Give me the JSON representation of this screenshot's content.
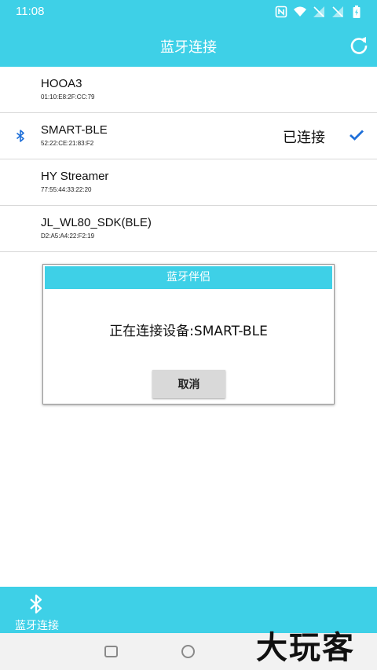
{
  "status_bar": {
    "time": "11:08"
  },
  "app_bar": {
    "title": "蓝牙连接"
  },
  "devices": [
    {
      "name": "HOOA3",
      "mac": "01:10:E8:2F:CC:79"
    },
    {
      "name": "SMART-BLE",
      "mac": "52:22:CE:21:83:F2",
      "status": "已连接"
    },
    {
      "name": "HY Streamer",
      "mac": "77:55:44:33:22:20"
    },
    {
      "name": "JL_WL80_SDK(BLE)",
      "mac": "D2:A5:A4:22:F2:19"
    }
  ],
  "dialog": {
    "title": "蓝牙伴侣",
    "message": "正在连接设备:SMART-BLE",
    "cancel_label": "取消"
  },
  "bottom_bar": {
    "tab_label": "蓝牙连接"
  },
  "watermark": "大玩客",
  "colors": {
    "accent": "#3ed0e7",
    "check": "#1e6fd9"
  },
  "icons": [
    "nfc-icon",
    "wifi-icon",
    "signal-icon",
    "battery-icon",
    "refresh-icon",
    "bluetooth-icon",
    "check-icon",
    "recent-apps-icon",
    "home-icon"
  ]
}
